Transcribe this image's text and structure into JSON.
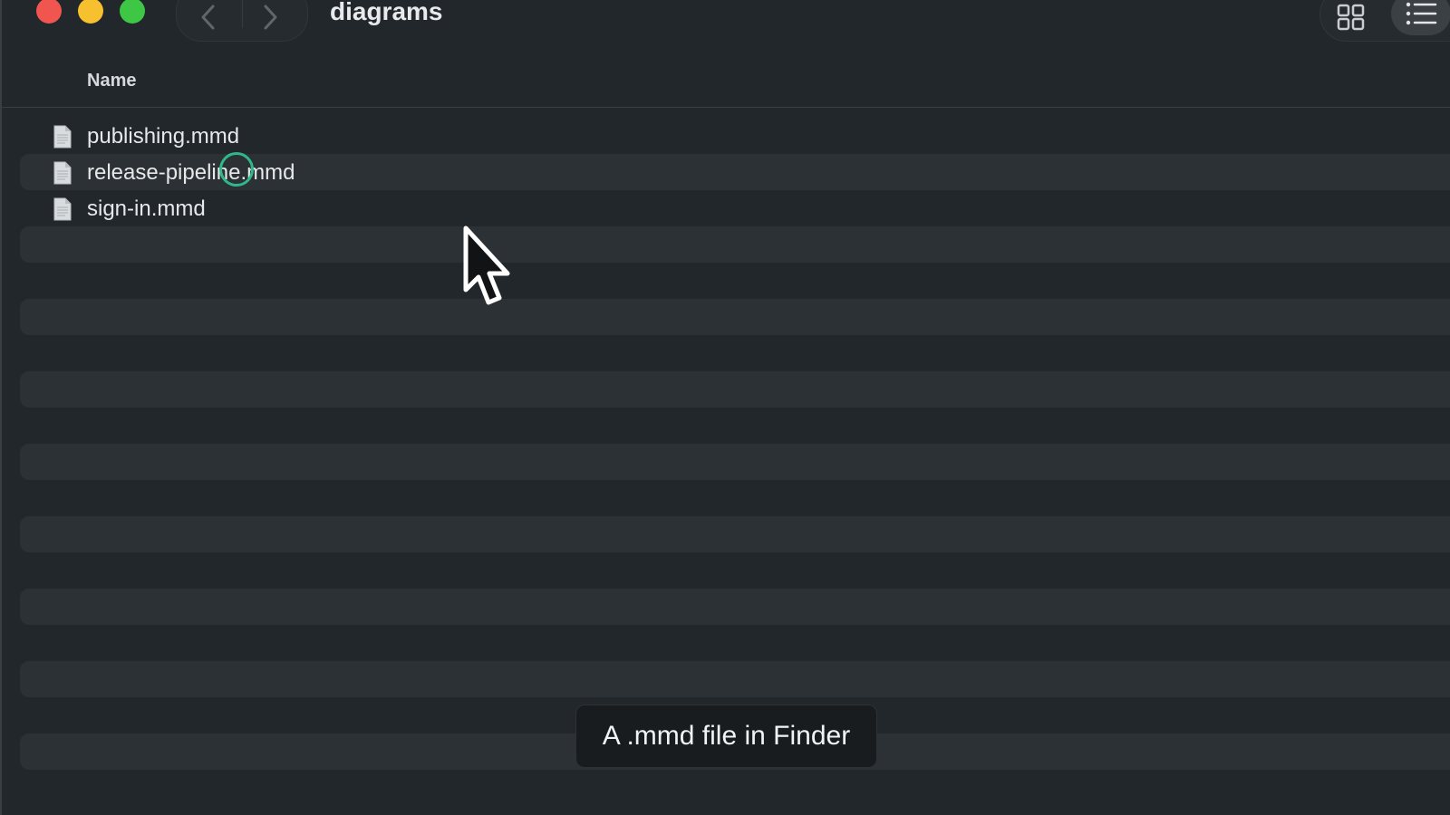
{
  "window": {
    "title": "diagrams"
  },
  "toolbar": {
    "back_icon": "chevron-left-icon",
    "forward_icon": "chevron-right-icon",
    "grid_view_icon": "grid-view-icon",
    "list_view_icon": "list-view-icon",
    "active_view": "list"
  },
  "list": {
    "columns": [
      {
        "label": "Name"
      }
    ],
    "files": [
      {
        "name": "publishing.mmd",
        "icon": "document-icon"
      },
      {
        "name": "release-pipeline.mmd",
        "icon": "document-icon"
      },
      {
        "name": "sign-in.mmd",
        "icon": "document-icon"
      }
    ]
  },
  "caption": {
    "text": "A .mmd file in Finder"
  },
  "colors": {
    "traffic_close": "#f0554f",
    "traffic_minimize": "#f7c02f",
    "traffic_maximize": "#3ec645",
    "click_highlight": "#2fb98b",
    "background": "#22272b",
    "stripe": "#2b3134"
  }
}
